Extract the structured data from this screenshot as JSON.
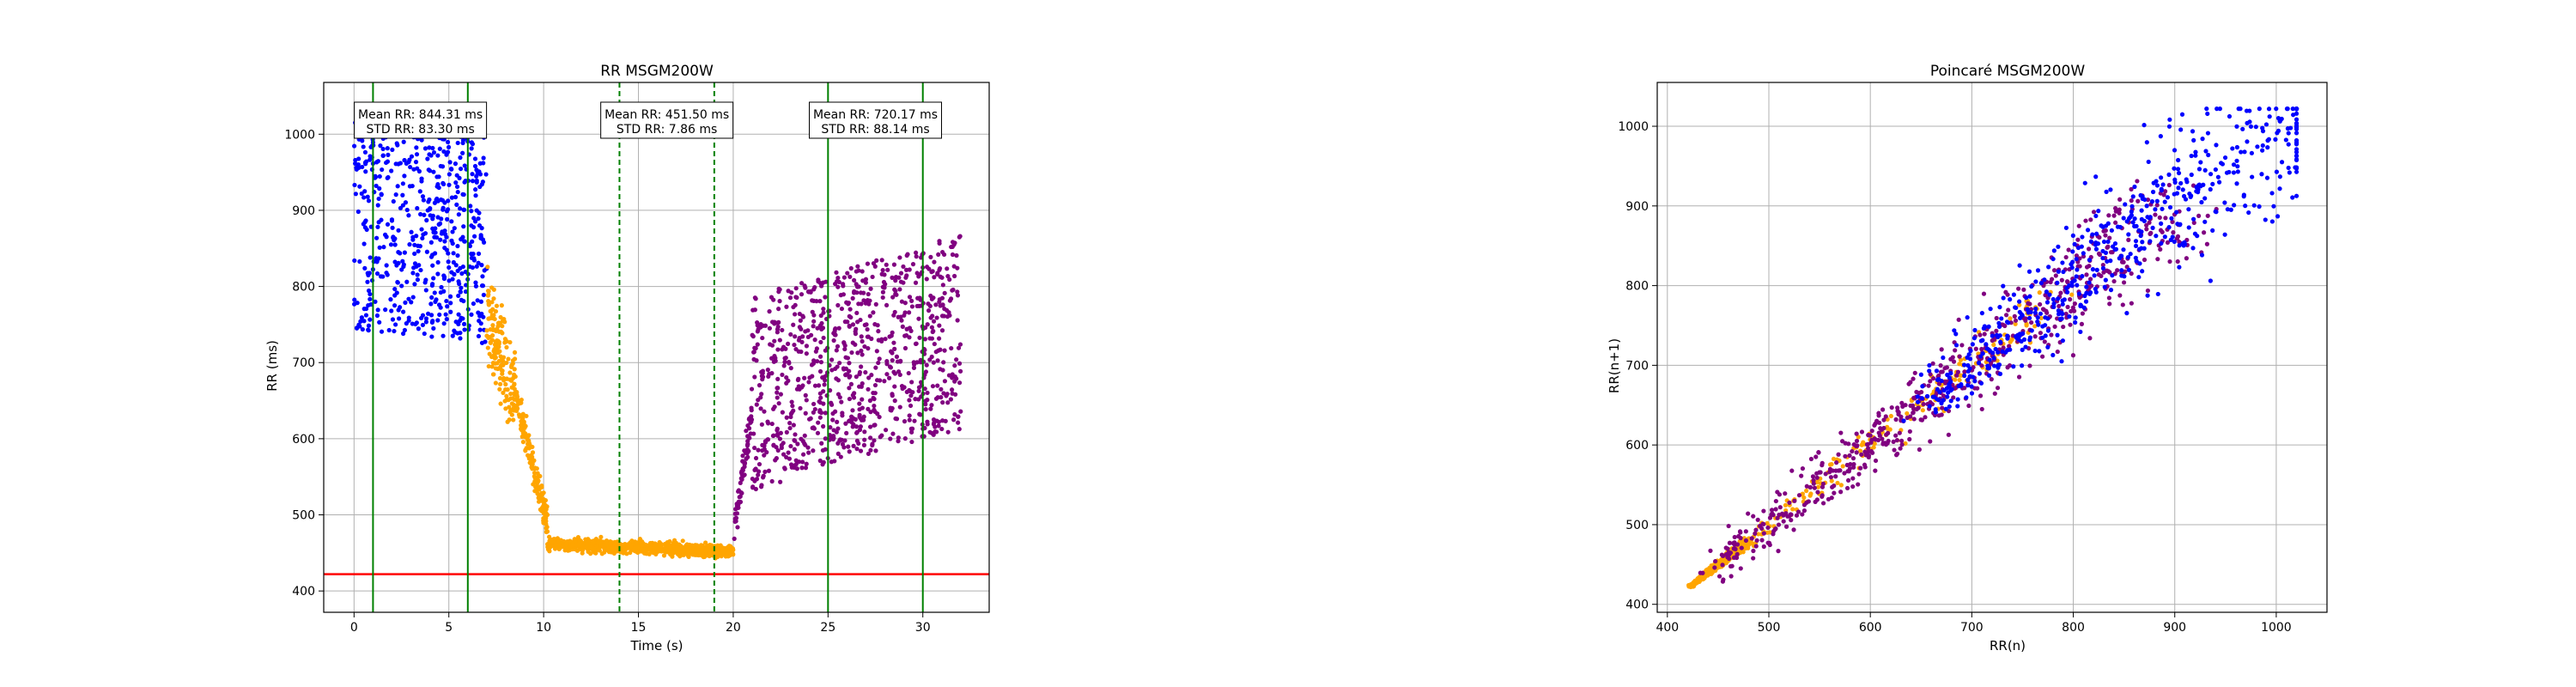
{
  "figure": {
    "colors": {
      "blue": "#0000ff",
      "orange": "#ffa500",
      "purple": "#800080",
      "green": "#008000",
      "red": "#ff0000",
      "grid": "#b0b0b0"
    }
  },
  "chart_data": [
    {
      "type": "scatter",
      "title": "RR MSGM200W",
      "xlabel": "Time (s)",
      "ylabel": "RR (ms)",
      "xlim": [
        -1.6,
        33.5
      ],
      "ylim": [
        372,
        1068
      ],
      "xticks": [
        0,
        5,
        10,
        15,
        20,
        25,
        30
      ],
      "yticks": [
        400,
        500,
        600,
        700,
        800,
        900,
        1000
      ],
      "grid": true,
      "threshold_line": {
        "y": 422,
        "color": "#ff0000"
      },
      "vertical_lines": [
        {
          "x": 1,
          "style": "solid",
          "color": "#008000"
        },
        {
          "x": 6,
          "style": "solid",
          "color": "#008000"
        },
        {
          "x": 14,
          "style": "dashed",
          "color": "#008000"
        },
        {
          "x": 19,
          "style": "dashed",
          "color": "#008000"
        },
        {
          "x": 25,
          "style": "solid",
          "color": "#008000"
        },
        {
          "x": 30,
          "style": "solid",
          "color": "#008000"
        }
      ],
      "annotations": [
        {
          "x": 3.5,
          "y": 1015,
          "line1": "Mean RR: 844.31 ms",
          "line2": "STD RR: 83.30 ms"
        },
        {
          "x": 16.5,
          "y": 1015,
          "line1": "Mean RR: 451.50 ms",
          "line2": "STD RR: 7.86 ms"
        },
        {
          "x": 27.5,
          "y": 1015,
          "line1": "Mean RR: 720.17 ms",
          "line2": "STD RR: 88.14 ms"
        }
      ],
      "segments": [
        {
          "color": "#0000ff",
          "t0": 0.0,
          "t1": 7.0,
          "start": 880,
          "end": 860,
          "spread": 85,
          "count": 560
        },
        {
          "color": "#ffa500",
          "t0": 7.0,
          "t1": 8.5,
          "start": 760,
          "end": 660,
          "spread": 55,
          "count": 160
        },
        {
          "color": "#ffa500",
          "t0": 8.5,
          "t1": 10.2,
          "start": 660,
          "end": 490,
          "spread": 25,
          "count": 160
        },
        {
          "color": "#ffa500",
          "t0": 10.2,
          "t1": 20.0,
          "start": 462,
          "end": 452,
          "spread": 8,
          "count": 900
        },
        {
          "color": "#800080",
          "t0": 20.0,
          "t1": 21.0,
          "start": 470,
          "end": 640,
          "spread": 25,
          "count": 70
        },
        {
          "color": "#800080",
          "t0": 21.0,
          "t1": 32.0,
          "start": 660,
          "end": 740,
          "spread": 80,
          "count": 900
        }
      ]
    },
    {
      "type": "scatter",
      "title": "Poincaré MSGM200W",
      "xlabel": "RR(n)",
      "ylabel": "RR(n+1)",
      "xlim": [
        390,
        1050
      ],
      "ylim": [
        390,
        1055
      ],
      "xticks": [
        400,
        500,
        600,
        700,
        800,
        900,
        1000
      ],
      "yticks": [
        400,
        500,
        600,
        700,
        800,
        900,
        1000
      ],
      "grid": true,
      "clusters": [
        {
          "color": "#ffa500",
          "min": 422,
          "max": 480,
          "spread": 4,
          "count": 600
        },
        {
          "color": "#ffa500",
          "min": 480,
          "max": 780,
          "spread": 18,
          "count": 180
        },
        {
          "color": "#800080",
          "min": 440,
          "max": 900,
          "spread": 40,
          "count": 650
        },
        {
          "color": "#0000ff",
          "min": 650,
          "max": 1020,
          "spread": 60,
          "count": 560
        }
      ]
    }
  ]
}
